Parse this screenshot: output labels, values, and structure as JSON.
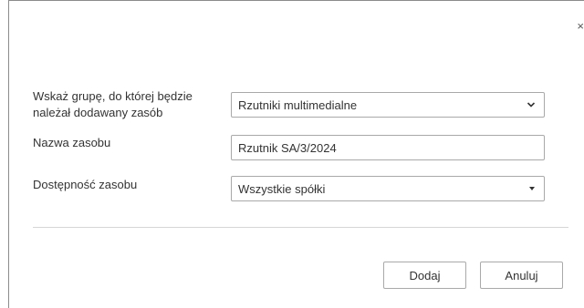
{
  "dialog": {
    "close_symbol": "×",
    "close_icon": "close-icon"
  },
  "form": {
    "group": {
      "label": "Wskaż grupę, do której będzie należał dodawany zasób",
      "value": "Rzutniki multimedialne",
      "icon": "chevron-down-icon"
    },
    "name": {
      "label": "Nazwa zasobu",
      "value": "Rzutnik SA/3/2024"
    },
    "availability": {
      "label": "Dostępność zasobu",
      "value": "Wszystkie spółki",
      "icon": "caret-down-icon"
    }
  },
  "buttons": {
    "add_label": "Dodaj",
    "cancel_label": "Anuluj"
  }
}
